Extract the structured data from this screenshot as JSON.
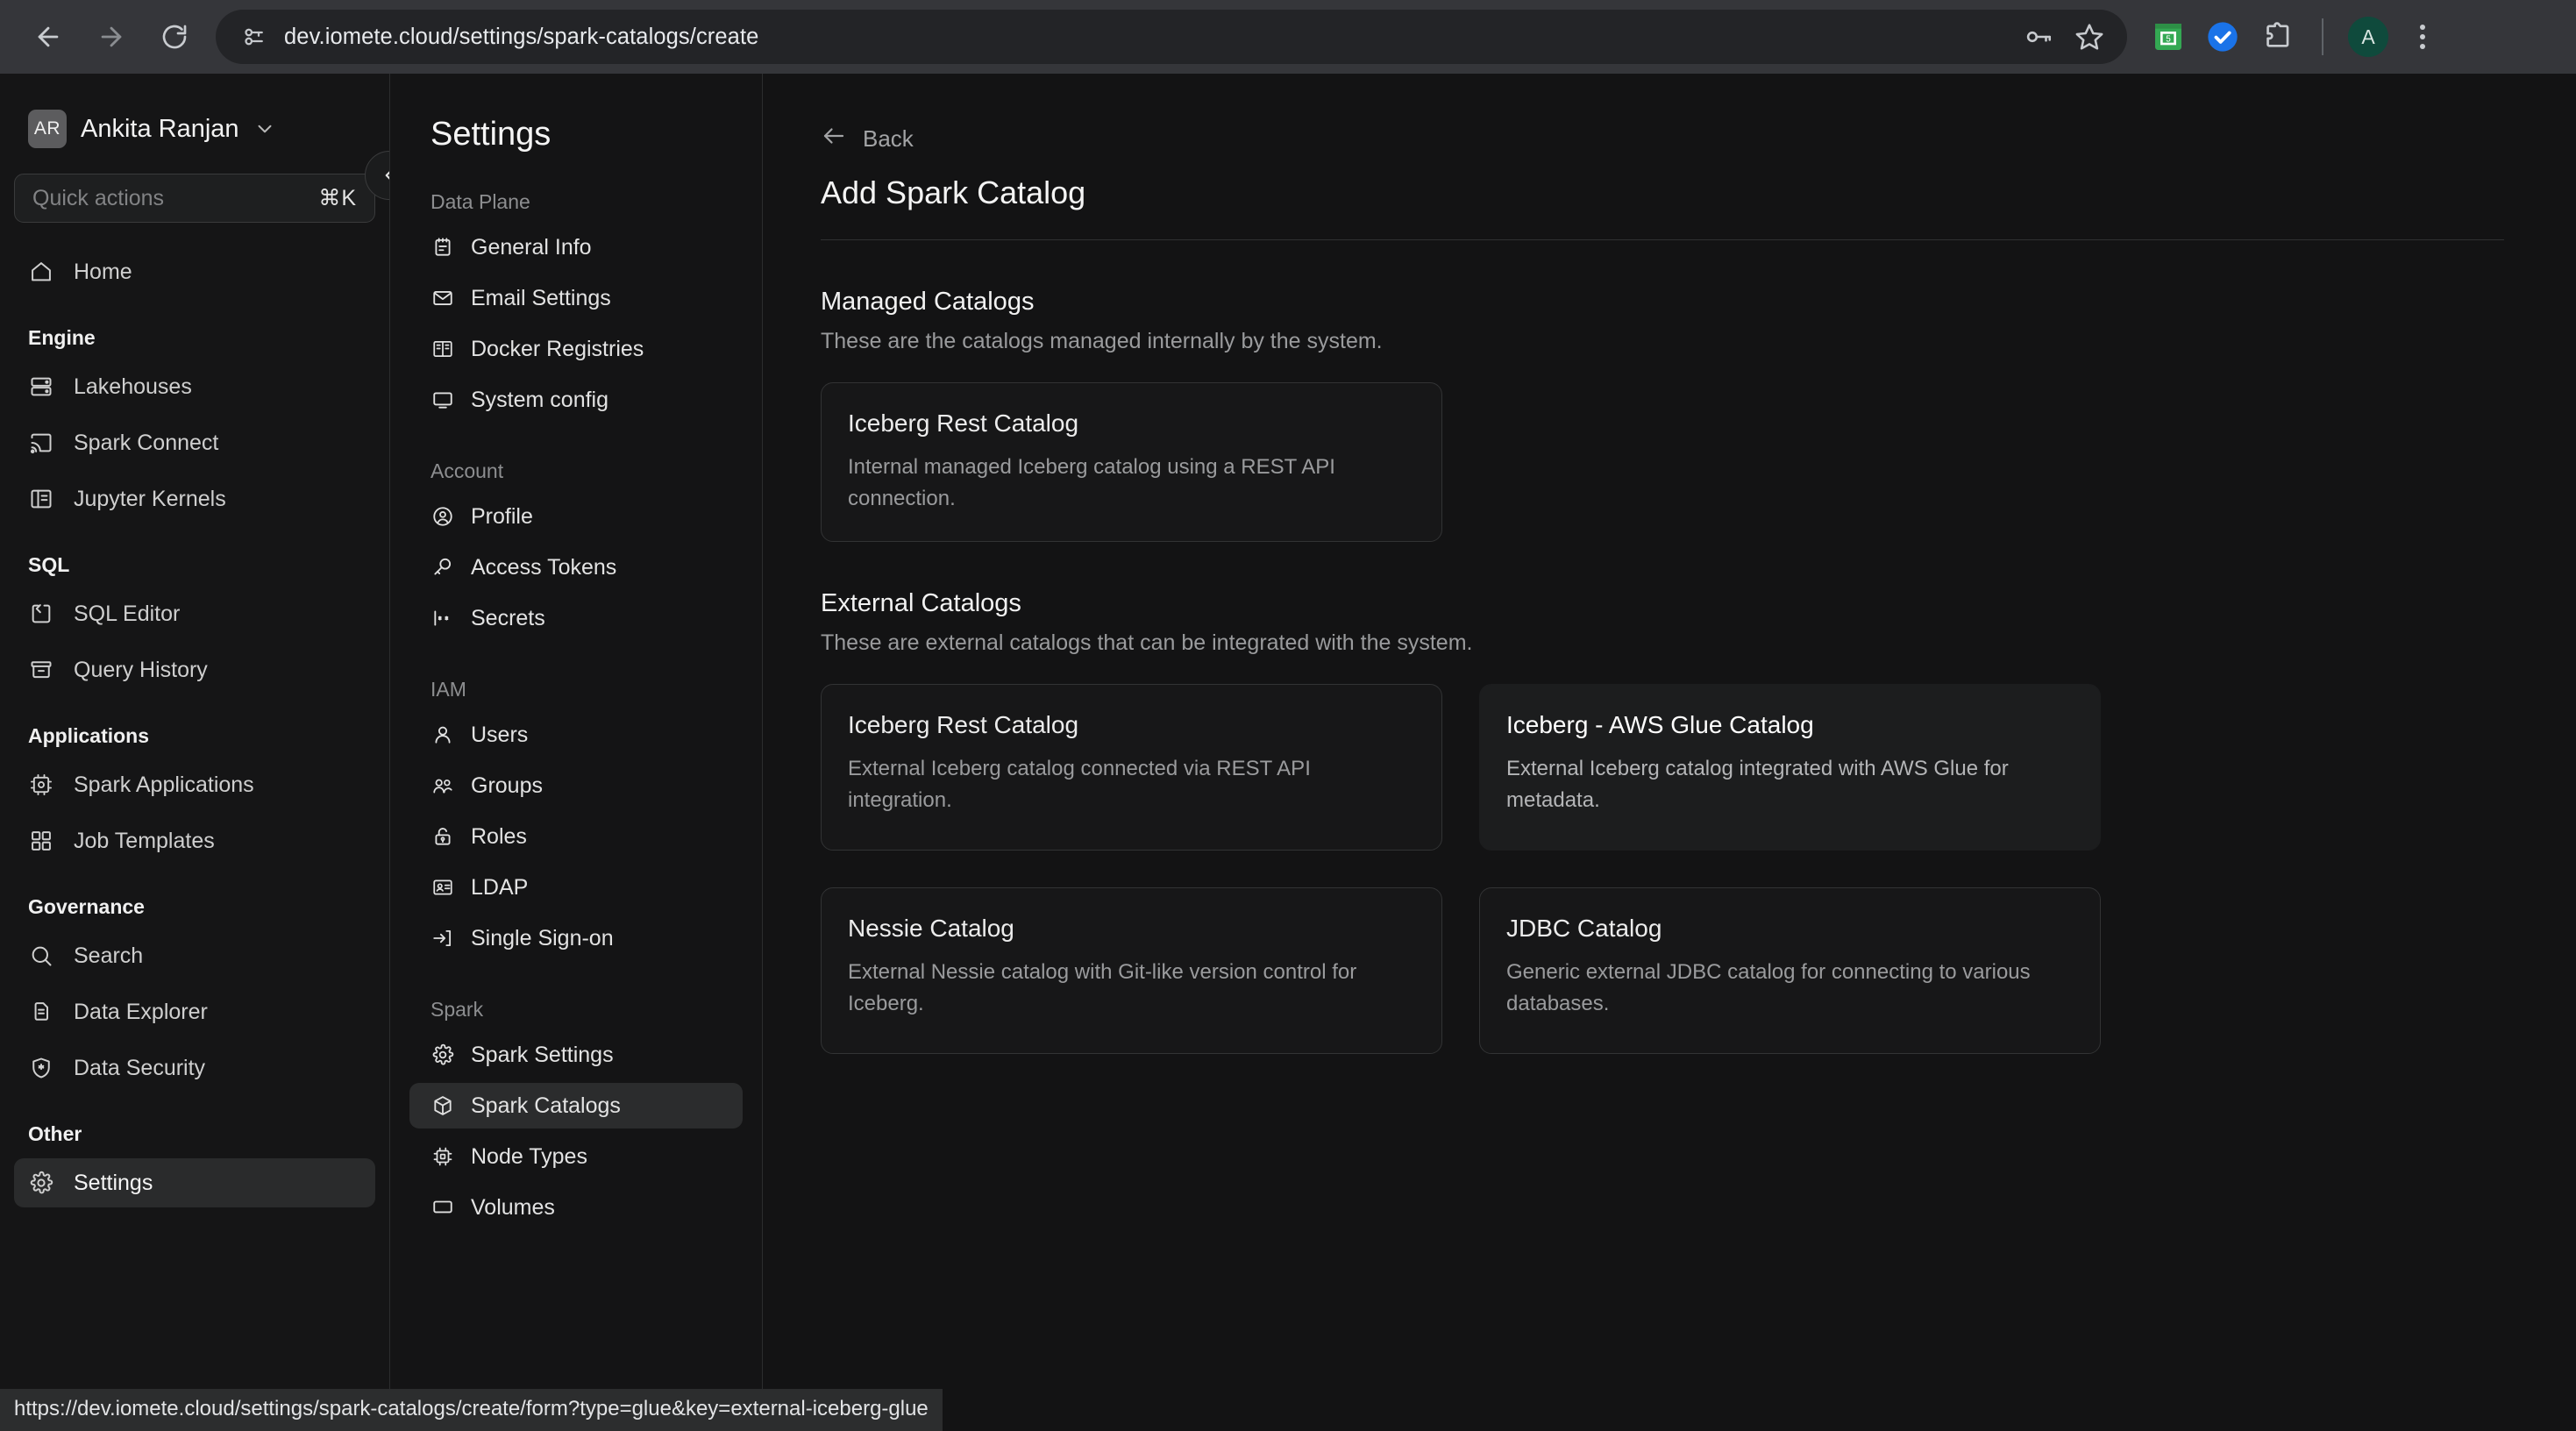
{
  "browser": {
    "url": "dev.iomete.cloud/settings/spark-catalogs/create",
    "back_tooltip": "Back",
    "forward_tooltip": "Forward",
    "reload_tooltip": "Reload",
    "profile_initial": "A",
    "icons": {
      "site_info": "site-info-icon",
      "password_key": "password-key-icon",
      "bookmark_star": "bookmark-star-icon",
      "extension_sheets": "google-sheets-extension-icon",
      "extension_check": "blue-check-extension-icon",
      "extensions_puzzle": "extensions-puzzle-icon",
      "menu": "chrome-menu-icon"
    }
  },
  "status_bar": {
    "url": "https://dev.iomete.cloud/settings/spark-catalogs/create/form?type=glue&key=external-iceberg-glue"
  },
  "sidebar": {
    "user": {
      "initials": "AR",
      "name": "Ankita Ranjan"
    },
    "quick_actions": {
      "placeholder": "Quick actions",
      "shortcut": "⌘K"
    },
    "collapse_label": "Collapse sidebar",
    "groups": [
      {
        "label": "",
        "items": [
          {
            "label": "Home",
            "icon": "home-icon",
            "active": false
          }
        ]
      },
      {
        "label": "Engine",
        "items": [
          {
            "label": "Lakehouses",
            "icon": "database-icon",
            "active": false
          },
          {
            "label": "Spark Connect",
            "icon": "cast-icon",
            "active": false
          },
          {
            "label": "Jupyter Kernels",
            "icon": "notebook-icon",
            "active": false
          }
        ]
      },
      {
        "label": "SQL",
        "items": [
          {
            "label": "SQL Editor",
            "icon": "code-brackets-icon",
            "active": false
          },
          {
            "label": "Query History",
            "icon": "archive-icon",
            "active": false
          }
        ]
      },
      {
        "label": "Applications",
        "items": [
          {
            "label": "Spark Applications",
            "icon": "cpu-icon",
            "active": false
          },
          {
            "label": "Job Templates",
            "icon": "grid-icon",
            "active": false
          }
        ]
      },
      {
        "label": "Governance",
        "items": [
          {
            "label": "Search",
            "icon": "search-icon",
            "active": false
          },
          {
            "label": "Data Explorer",
            "icon": "documents-icon",
            "active": false
          },
          {
            "label": "Data Security",
            "icon": "shield-star-icon",
            "active": false
          }
        ]
      },
      {
        "label": "Other",
        "items": [
          {
            "label": "Settings",
            "icon": "gear-icon",
            "active": true
          }
        ]
      }
    ]
  },
  "settings_panel": {
    "title": "Settings",
    "groups": [
      {
        "label": "Data Plane",
        "items": [
          {
            "label": "General Info",
            "icon": "clipboard-icon",
            "active": false
          },
          {
            "label": "Email Settings",
            "icon": "mail-icon",
            "active": false
          },
          {
            "label": "Docker Registries",
            "icon": "containers-icon",
            "active": false
          },
          {
            "label": "System config",
            "icon": "monitor-icon",
            "active": false
          }
        ]
      },
      {
        "label": "Account",
        "items": [
          {
            "label": "Profile",
            "icon": "user-circle-icon",
            "active": false
          },
          {
            "label": "Access Tokens",
            "icon": "key-icon",
            "active": false
          },
          {
            "label": "Secrets",
            "icon": "asterisk-secret-icon",
            "active": false
          }
        ]
      },
      {
        "label": "IAM",
        "items": [
          {
            "label": "Users",
            "icon": "user-icon",
            "active": false
          },
          {
            "label": "Groups",
            "icon": "users-group-icon",
            "active": false
          },
          {
            "label": "Roles",
            "icon": "lock-icon",
            "active": false
          },
          {
            "label": "LDAP",
            "icon": "id-card-icon",
            "active": false
          },
          {
            "label": "Single Sign-on",
            "icon": "sign-in-icon",
            "active": false
          }
        ]
      },
      {
        "label": "Spark",
        "items": [
          {
            "label": "Spark Settings",
            "icon": "gear-icon",
            "active": false
          },
          {
            "label": "Spark Catalogs",
            "icon": "cube-icon",
            "active": true
          },
          {
            "label": "Node Types",
            "icon": "chip-icon",
            "active": false
          },
          {
            "label": "Volumes",
            "icon": "volume-icon",
            "active": false
          }
        ]
      }
    ]
  },
  "main": {
    "back_label": "Back",
    "page_title": "Add Spark Catalog",
    "managed": {
      "title": "Managed Catalogs",
      "subtitle": "These are the catalogs managed internally by the system.",
      "cards": [
        {
          "name": "Iceberg Rest Catalog",
          "description": "Internal managed Iceberg catalog using a REST API connection.",
          "hovered": false
        }
      ]
    },
    "external": {
      "title": "External Catalogs",
      "subtitle": "These are external catalogs that can be integrated with the system.",
      "cards": [
        {
          "name": "Iceberg Rest Catalog",
          "description": "External Iceberg catalog connected via REST API integration.",
          "hovered": false
        },
        {
          "name": "Iceberg - AWS Glue Catalog",
          "description": "External Iceberg catalog integrated with AWS Glue for metadata.",
          "hovered": true
        },
        {
          "name": "Nessie Catalog",
          "description": "External Nessie catalog with Git-like version control for Iceberg.",
          "hovered": false
        },
        {
          "name": "JDBC Catalog",
          "description": "Generic external JDBC catalog for connecting to various databases.",
          "hovered": false
        }
      ]
    }
  },
  "colors": {
    "app_bg": "#121212",
    "chrome_bg": "#35363a",
    "sidebar_bg": "#151516",
    "active_item": "#2a2b2c",
    "accent_avatar": "#0f4a3c",
    "extension_green": "#34a853",
    "extension_blue": "#1a73e8"
  }
}
